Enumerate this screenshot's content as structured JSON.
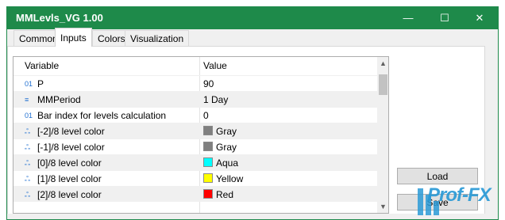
{
  "window": {
    "title": "MMLevls_VG 1.00",
    "minimize_glyph": "—",
    "maximize_glyph": "☐",
    "close_glyph": "✕"
  },
  "tabs": [
    {
      "label": "Common",
      "active": false
    },
    {
      "label": "Inputs",
      "active": true
    },
    {
      "label": "Colors",
      "active": false
    },
    {
      "label": "Visualization",
      "active": false
    }
  ],
  "grid": {
    "columns": [
      "Variable",
      "Value"
    ],
    "rows": [
      {
        "icon": "int-icon",
        "glyph": "01",
        "name": "P",
        "value": "90"
      },
      {
        "icon": "enum-icon",
        "glyph": "≡",
        "name": "MMPeriod",
        "value": "1 Day"
      },
      {
        "icon": "int-icon",
        "glyph": "01",
        "name": "Bar index for levels calculation",
        "value": "0"
      },
      {
        "icon": "color-icon",
        "glyph": "ஃ",
        "name": "[-2]/8 level color",
        "value": "Gray",
        "color": "#808080"
      },
      {
        "icon": "color-icon",
        "glyph": "ஃ",
        "name": "[-1]/8 level color",
        "value": "Gray",
        "color": "#808080"
      },
      {
        "icon": "color-icon",
        "glyph": "ஃ",
        "name": "[0]/8 level color",
        "value": "Aqua",
        "color": "#00ffff"
      },
      {
        "icon": "color-icon",
        "glyph": "ஃ",
        "name": "[1]/8 level color",
        "value": "Yellow",
        "color": "#ffff00"
      },
      {
        "icon": "color-icon",
        "glyph": "ஃ",
        "name": "[2]/8 level color",
        "value": "Red",
        "color": "#ff0000"
      }
    ]
  },
  "buttons": {
    "load": "Load",
    "save": "Save"
  },
  "watermark": "Prof-FX"
}
